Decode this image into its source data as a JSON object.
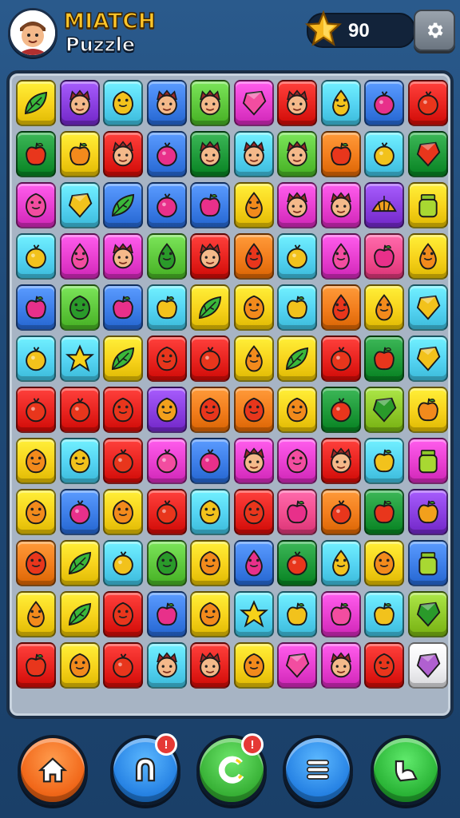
{
  "header": {
    "title_line1": "MIATCH",
    "title_line2": "Puzzle",
    "avatar_icon": "player-avatar",
    "score_icon": "star-icon",
    "score": "90",
    "settings_icon": "gear-icon"
  },
  "colors": {
    "Y": "#f7d21b",
    "B": "#3d7ee8",
    "C": "#54d3f2",
    "G": "#5ec83c",
    "D": "#1f9a3a",
    "R": "#e8231f",
    "P": "#e83fd0",
    "V": "#8a3fe0",
    "O": "#f27d1c",
    "L": "#8fc92a",
    "K": "#f24d8f",
    "W": "#f1f1f4"
  },
  "board": {
    "rows": [
      [
        [
          "Y",
          "leaf"
        ],
        [
          "V",
          "face"
        ],
        [
          "C",
          "smile"
        ],
        [
          "B",
          "face"
        ],
        [
          "G",
          "face"
        ],
        [
          "P",
          "gem"
        ],
        [
          "R",
          "face"
        ],
        [
          "C",
          "drop"
        ],
        [
          "B",
          "berry"
        ],
        [
          "R",
          "berry"
        ]
      ],
      [
        [
          "D",
          "apple"
        ],
        [
          "Y",
          "apple"
        ],
        [
          "R",
          "face"
        ],
        [
          "B",
          "berry"
        ],
        [
          "D",
          "face"
        ],
        [
          "C",
          "face"
        ],
        [
          "G",
          "face"
        ],
        [
          "O",
          "apple"
        ],
        [
          "C",
          "berry"
        ],
        [
          "D",
          "gem"
        ]
      ],
      [
        [
          "P",
          "smile"
        ],
        [
          "C",
          "gem"
        ],
        [
          "B",
          "leaf"
        ],
        [
          "B",
          "berry"
        ],
        [
          "B",
          "apple"
        ],
        [
          "Y",
          "drop"
        ],
        [
          "P",
          "face"
        ],
        [
          "P",
          "face"
        ],
        [
          "V",
          "shell"
        ],
        [
          "Y",
          "jar"
        ]
      ],
      [
        [
          "C",
          "berry"
        ],
        [
          "P",
          "drop"
        ],
        [
          "P",
          "face"
        ],
        [
          "G",
          "drop"
        ],
        [
          "R",
          "face"
        ],
        [
          "O",
          "drop"
        ],
        [
          "C",
          "berry"
        ],
        [
          "P",
          "drop"
        ],
        [
          "K",
          "apple"
        ],
        [
          "Y",
          "drop"
        ]
      ],
      [
        [
          "B",
          "apple"
        ],
        [
          "G",
          "smile"
        ],
        [
          "B",
          "apple"
        ],
        [
          "C",
          "apple"
        ],
        [
          "Y",
          "leaf"
        ],
        [
          "Y",
          "smile"
        ],
        [
          "C",
          "apple"
        ],
        [
          "O",
          "drop"
        ],
        [
          "Y",
          "drop"
        ],
        [
          "C",
          "gem"
        ]
      ],
      [
        [
          "C",
          "berry"
        ],
        [
          "C",
          "star"
        ],
        [
          "Y",
          "leaf"
        ],
        [
          "R",
          "smile"
        ],
        [
          "R",
          "berry"
        ],
        [
          "Y",
          "drop"
        ],
        [
          "Y",
          "leaf"
        ],
        [
          "R",
          "berry"
        ],
        [
          "D",
          "apple"
        ],
        [
          "C",
          "gem"
        ]
      ],
      [
        [
          "R",
          "berry"
        ],
        [
          "R",
          "berry"
        ],
        [
          "R",
          "smile"
        ],
        [
          "V",
          "smile"
        ],
        [
          "O",
          "smile"
        ],
        [
          "O",
          "smile"
        ],
        [
          "Y",
          "smile"
        ],
        [
          "D",
          "berry"
        ],
        [
          "L",
          "gem"
        ],
        [
          "Y",
          "apple"
        ]
      ],
      [
        [
          "Y",
          "smile"
        ],
        [
          "C",
          "smile"
        ],
        [
          "R",
          "berry"
        ],
        [
          "P",
          "berry"
        ],
        [
          "B",
          "berry"
        ],
        [
          "P",
          "face"
        ],
        [
          "P",
          "smile"
        ],
        [
          "R",
          "face"
        ],
        [
          "C",
          "apple"
        ],
        [
          "P",
          "jar"
        ]
      ],
      [
        [
          "Y",
          "smile"
        ],
        [
          "B",
          "berry"
        ],
        [
          "Y",
          "smile"
        ],
        [
          "R",
          "berry"
        ],
        [
          "C",
          "smile"
        ],
        [
          "R",
          "smile"
        ],
        [
          "K",
          "apple"
        ],
        [
          "O",
          "berry"
        ],
        [
          "D",
          "apple"
        ],
        [
          "V",
          "apple"
        ]
      ],
      [
        [
          "O",
          "smile"
        ],
        [
          "Y",
          "leaf"
        ],
        [
          "C",
          "berry"
        ],
        [
          "G",
          "smile"
        ],
        [
          "Y",
          "smile"
        ],
        [
          "B",
          "drop"
        ],
        [
          "D",
          "berry"
        ],
        [
          "C",
          "drop"
        ],
        [
          "Y",
          "smile"
        ],
        [
          "B",
          "jar"
        ]
      ],
      [
        [
          "Y",
          "drop"
        ],
        [
          "Y",
          "leaf"
        ],
        [
          "R",
          "smile"
        ],
        [
          "B",
          "apple"
        ],
        [
          "Y",
          "smile"
        ],
        [
          "C",
          "star"
        ],
        [
          "C",
          "apple"
        ],
        [
          "P",
          "apple"
        ],
        [
          "C",
          "apple"
        ],
        [
          "L",
          "gem"
        ]
      ],
      [
        [
          "R",
          "apple"
        ],
        [
          "Y",
          "smile"
        ],
        [
          "R",
          "berry"
        ],
        [
          "C",
          "face"
        ],
        [
          "R",
          "face"
        ],
        [
          "Y",
          "smile"
        ],
        [
          "P",
          "gem"
        ],
        [
          "P",
          "face"
        ],
        [
          "R",
          "smile"
        ],
        [
          "W",
          "gem"
        ]
      ]
    ]
  },
  "nav": [
    {
      "icon": "home-icon",
      "color": "#f26a1c",
      "badge": ""
    },
    {
      "icon": "magnet-icon",
      "color": "#2a86e6",
      "badge": "!"
    },
    {
      "icon": "refresh-icon",
      "color": "#3cb53a",
      "badge": "!"
    },
    {
      "icon": "layers-icon",
      "color": "#2a86e6",
      "badge": ""
    },
    {
      "icon": "hint-icon",
      "color": "#2eb83a",
      "badge": ""
    }
  ]
}
